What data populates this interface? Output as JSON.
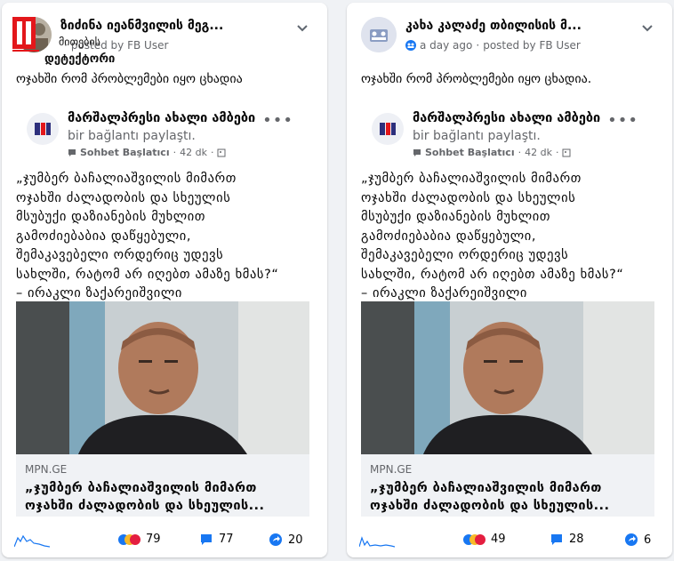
{
  "posts": [
    {
      "page_name": "ზიძინა იეანმვილის მეგ...",
      "time": "",
      "posted_by": "posted by FB User",
      "caption": "ოჯახში რომ პრობლემები იყო ცხადია",
      "embed": {
        "page_name": "მარშალპრესი ახალი ამბები",
        "shared": "bir bağlantı paylaştı.",
        "chat": "Sohbet Başlatıcı",
        "age": "42 dk",
        "quote": [
          "„ჯუმბერ ბაჩალიაშვილის მიმართ",
          "ოჯახში ძალადობის და სხეულის",
          "მსუბუქი დაზიანების მუხლით",
          "გამოძიებაბია დაწყებული,",
          "შემაკავებელი ორდერიც უდევს",
          "სახლში, რატომ არ იღებთ ამაზე ხმას?“",
          "– ირაკლი ზაქარეიშვილი"
        ],
        "domain": "MPN.GE",
        "link_title": [
          "„ჯუმბერ ბაჩალიაშვილის მიმართ",
          "ოჯახში ძალადობის და სხეულის..."
        ]
      },
      "stats": {
        "reactions": "79",
        "comments": "77",
        "shares": "20"
      }
    },
    {
      "page_name": "კახა კალაძე თბილისის მ...",
      "time": "a day ago",
      "posted_by": "posted by FB User",
      "caption": "ოჯახში რომ პრობლემები იყო ცხადია.",
      "embed": {
        "page_name": "მარშალპრესი ახალი ამბები",
        "shared": "bir bağlantı paylaştı.",
        "chat": "Sohbet Başlatıcı",
        "age": "42 dk",
        "quote": [
          "„ჯუმბერ ბაჩალიაშვილის მიმართ",
          "ოჯახში ძალადობის და სხეულის",
          "მსუბუქი დაზიანების მუხლით",
          "გამოძიებაბია დაწყებული,",
          "შემაკავებელი ორდერიც უდევს",
          "სახლში, რატომ არ იღებთ ამაზე ხმას?“",
          "– ირაკლი ზაქარეიშვილი"
        ],
        "domain": "MPN.GE",
        "link_title": [
          "„ჯუმბერ ბაჩალიაშვილის მიმართ",
          "ოჯახში ძალადობის და სხეულის..."
        ]
      },
      "stats": {
        "reactions": "49",
        "comments": "28",
        "shares": "6"
      }
    }
  ],
  "watermark": {
    "line1": "მითების",
    "line2": "დეტექტორი"
  },
  "colors": {
    "link_blue": "#1877f2",
    "muted": "#65676b",
    "watermark_red": "#e3171b"
  }
}
